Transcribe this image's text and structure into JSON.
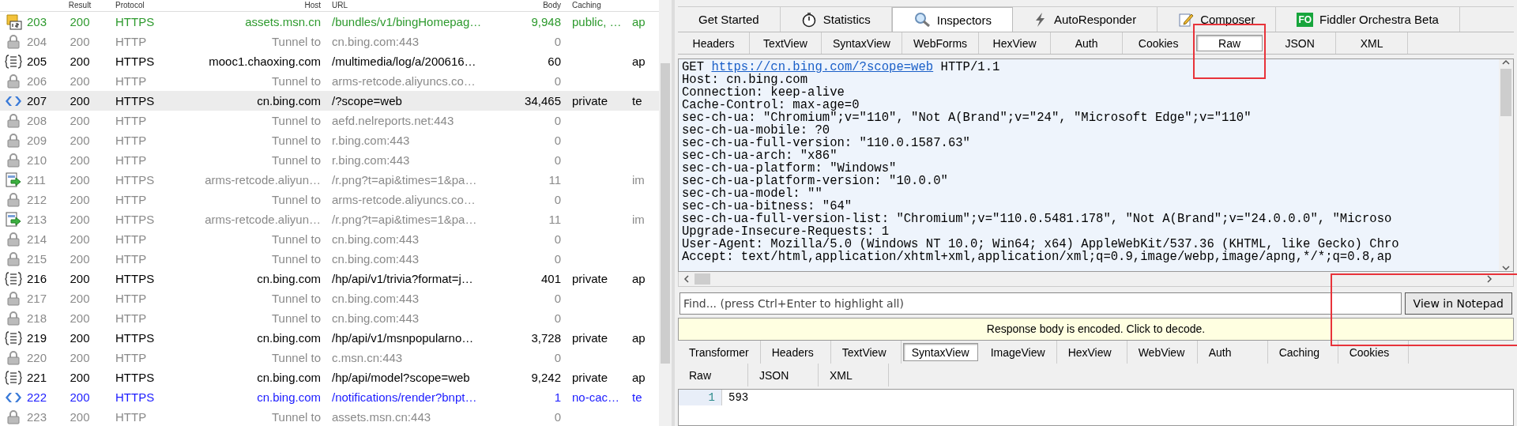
{
  "sessions": {
    "columns": [
      "Result",
      "Protocol",
      "Host",
      "URL",
      "Body",
      "Caching"
    ],
    "rows": [
      {
        "kind": "script",
        "id": "203",
        "result": "200",
        "protocol": "HTTPS",
        "host": "assets.msn.cn",
        "url": "/bundles/v1/bingHomepag…",
        "body": "9,948",
        "caching": "public, …",
        "column_8": "ap",
        "color": "#2e9a2e",
        "selected": false
      },
      {
        "kind": "tunnel",
        "id": "204",
        "result": "200",
        "protocol": "HTTP",
        "host": "Tunnel to",
        "url": "cn.bing.com:443",
        "body": "0",
        "caching": "",
        "column_8": "",
        "color": "#8a8a8a",
        "selected": false
      },
      {
        "kind": "json",
        "id": "205",
        "result": "200",
        "protocol": "HTTPS",
        "host": "mooc1.chaoxing.com",
        "url": "/multimedia/log/a/200616…",
        "body": "60",
        "caching": "",
        "column_8": "ap",
        "color": "#000000",
        "selected": false
      },
      {
        "kind": "tunnel",
        "id": "206",
        "result": "200",
        "protocol": "HTTP",
        "host": "Tunnel to",
        "url": "arms-retcode.aliyuncs.co…",
        "body": "0",
        "caching": "",
        "column_8": "",
        "color": "#8a8a8a",
        "selected": false
      },
      {
        "kind": "html",
        "id": "207",
        "result": "200",
        "protocol": "HTTPS",
        "host": "cn.bing.com",
        "url": "/?scope=web",
        "body": "34,465",
        "caching": "private",
        "column_8": "te",
        "color": "#000000",
        "selected": true
      },
      {
        "kind": "tunnel",
        "id": "208",
        "result": "200",
        "protocol": "HTTP",
        "host": "Tunnel to",
        "url": "aefd.nelreports.net:443",
        "body": "0",
        "caching": "",
        "column_8": "",
        "color": "#8a8a8a",
        "selected": false
      },
      {
        "kind": "tunnel",
        "id": "209",
        "result": "200",
        "protocol": "HTTP",
        "host": "Tunnel to",
        "url": "r.bing.com:443",
        "body": "0",
        "caching": "",
        "column_8": "",
        "color": "#8a8a8a",
        "selected": false
      },
      {
        "kind": "tunnel",
        "id": "210",
        "result": "200",
        "protocol": "HTTP",
        "host": "Tunnel to",
        "url": "r.bing.com:443",
        "body": "0",
        "caching": "",
        "column_8": "",
        "color": "#8a8a8a",
        "selected": false
      },
      {
        "kind": "image",
        "id": "211",
        "result": "200",
        "protocol": "HTTPS",
        "host": "arms-retcode.aliyun…",
        "url": "/r.png?t=api&times=1&pa…",
        "body": "11",
        "caching": "",
        "column_8": "im",
        "color": "#8a8a8a",
        "selected": false
      },
      {
        "kind": "tunnel",
        "id": "212",
        "result": "200",
        "protocol": "HTTP",
        "host": "Tunnel to",
        "url": "arms-retcode.aliyuncs.co…",
        "body": "0",
        "caching": "",
        "column_8": "",
        "color": "#8a8a8a",
        "selected": false
      },
      {
        "kind": "image",
        "id": "213",
        "result": "200",
        "protocol": "HTTPS",
        "host": "arms-retcode.aliyun…",
        "url": "/r.png?t=api&times=1&pa…",
        "body": "11",
        "caching": "",
        "column_8": "im",
        "color": "#8a8a8a",
        "selected": false
      },
      {
        "kind": "tunnel",
        "id": "214",
        "result": "200",
        "protocol": "HTTP",
        "host": "Tunnel to",
        "url": "cn.bing.com:443",
        "body": "0",
        "caching": "",
        "column_8": "",
        "color": "#8a8a8a",
        "selected": false
      },
      {
        "kind": "tunnel",
        "id": "215",
        "result": "200",
        "protocol": "HTTP",
        "host": "Tunnel to",
        "url": "cn.bing.com:443",
        "body": "0",
        "caching": "",
        "column_8": "",
        "color": "#8a8a8a",
        "selected": false
      },
      {
        "kind": "json",
        "id": "216",
        "result": "200",
        "protocol": "HTTPS",
        "host": "cn.bing.com",
        "url": "/hp/api/v1/trivia?format=j…",
        "body": "401",
        "caching": "private",
        "column_8": "ap",
        "color": "#000000",
        "selected": false
      },
      {
        "kind": "tunnel",
        "id": "217",
        "result": "200",
        "protocol": "HTTP",
        "host": "Tunnel to",
        "url": "cn.bing.com:443",
        "body": "0",
        "caching": "",
        "column_8": "",
        "color": "#8a8a8a",
        "selected": false
      },
      {
        "kind": "tunnel",
        "id": "218",
        "result": "200",
        "protocol": "HTTP",
        "host": "Tunnel to",
        "url": "cn.bing.com:443",
        "body": "0",
        "caching": "",
        "column_8": "",
        "color": "#8a8a8a",
        "selected": false
      },
      {
        "kind": "json",
        "id": "219",
        "result": "200",
        "protocol": "HTTPS",
        "host": "cn.bing.com",
        "url": "/hp/api/v1/msnpopularno…",
        "body": "3,728",
        "caching": "private",
        "column_8": "ap",
        "color": "#000000",
        "selected": false
      },
      {
        "kind": "tunnel",
        "id": "220",
        "result": "200",
        "protocol": "HTTP",
        "host": "Tunnel to",
        "url": "c.msn.cn:443",
        "body": "0",
        "caching": "",
        "column_8": "",
        "color": "#8a8a8a",
        "selected": false
      },
      {
        "kind": "json",
        "id": "221",
        "result": "200",
        "protocol": "HTTPS",
        "host": "cn.bing.com",
        "url": "/hp/api/model?scope=web",
        "body": "9,242",
        "caching": "private",
        "column_8": "ap",
        "color": "#000000",
        "selected": false
      },
      {
        "kind": "html",
        "id": "222",
        "result": "200",
        "protocol": "HTTPS",
        "host": "cn.bing.com",
        "url": "/notifications/render?bnpt…",
        "body": "1",
        "caching": "no-cac…",
        "column_8": "te",
        "color": "#1a1aff",
        "selected": false
      },
      {
        "kind": "tunnel",
        "id": "223",
        "result": "200",
        "protocol": "HTTP",
        "host": "Tunnel to",
        "url": "assets.msn.cn:443",
        "body": "0",
        "caching": "",
        "column_8": "",
        "color": "#8a8a8a",
        "selected": false
      }
    ]
  },
  "main_tabs": [
    {
      "label": "Get Started",
      "selected": false
    },
    {
      "label": "Statistics",
      "selected": false
    },
    {
      "label": "Inspectors",
      "selected": true
    },
    {
      "label": "AutoResponder",
      "selected": false
    },
    {
      "label": "Composer",
      "selected": false
    },
    {
      "label": "Fiddler Orchestra Beta",
      "badge": "FO",
      "selected": false
    }
  ],
  "request_tabs": [
    {
      "label": "Headers",
      "selected": false
    },
    {
      "label": "TextView",
      "selected": false
    },
    {
      "label": "SyntaxView",
      "selected": false
    },
    {
      "label": "WebForms",
      "selected": false
    },
    {
      "label": "HexView",
      "selected": false
    },
    {
      "label": "Auth",
      "selected": false
    },
    {
      "label": "Cookies",
      "selected": false
    },
    {
      "label": "Raw",
      "selected": true
    },
    {
      "label": "JSON",
      "selected": false
    },
    {
      "label": "XML",
      "selected": false
    }
  ],
  "request_raw": {
    "method": "GET",
    "url": "https://cn.bing.com/?scope=web",
    "version": "HTTP/1.1",
    "lines": [
      "Host: cn.bing.com",
      "Connection: keep-alive",
      "Cache-Control: max-age=0",
      "sec-ch-ua: \"Chromium\";v=\"110\", \"Not A(Brand\";v=\"24\", \"Microsoft Edge\";v=\"110\"",
      "sec-ch-ua-mobile: ?0",
      "sec-ch-ua-full-version: \"110.0.1587.63\"",
      "sec-ch-ua-arch: \"x86\"",
      "sec-ch-ua-platform: \"Windows\"",
      "sec-ch-ua-platform-version: \"10.0.0\"",
      "sec-ch-ua-model: \"\"",
      "sec-ch-ua-bitness: \"64\"",
      "sec-ch-ua-full-version-list: \"Chromium\";v=\"110.0.5481.178\", \"Not A(Brand\";v=\"24.0.0.0\", \"Microso",
      "Upgrade-Insecure-Requests: 1",
      "User-Agent: Mozilla/5.0 (Windows NT 10.0; Win64; x64) AppleWebKit/537.36 (KHTML, like Gecko) Chro",
      "Accept: text/html,application/xhtml+xml,application/xml;q=0.9,image/webp,image/apng,*/*;q=0.8,ap"
    ]
  },
  "find": {
    "placeholder": "Find... (press Ctrl+Enter to highlight all)",
    "button": "View in Notepad"
  },
  "decode_bar": "Response body is encoded. Click to decode.",
  "response_tabs": [
    [
      {
        "label": "Transformer",
        "selected": false
      },
      {
        "label": "Headers",
        "selected": false
      },
      {
        "label": "TextView",
        "selected": false
      },
      {
        "label": "SyntaxView",
        "selected": true
      },
      {
        "label": "ImageView",
        "selected": false
      },
      {
        "label": "HexView",
        "selected": false
      },
      {
        "label": "WebView",
        "selected": false
      },
      {
        "label": "Auth",
        "selected": false
      },
      {
        "label": "Caching",
        "selected": false
      },
      {
        "label": "Cookies",
        "selected": false
      }
    ],
    [
      {
        "label": "Raw",
        "selected": false
      },
      {
        "label": "JSON",
        "selected": false
      },
      {
        "label": "XML",
        "selected": false
      }
    ]
  ],
  "response_body": [
    {
      "line_number": "1",
      "text": "593"
    }
  ]
}
